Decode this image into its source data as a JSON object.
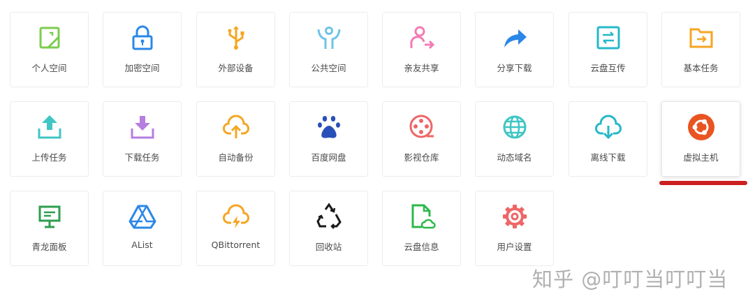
{
  "tiles": [
    {
      "label": "个人空间",
      "icon": "personal-space-icon",
      "color": "#7ccc4f"
    },
    {
      "label": "加密空间",
      "icon": "lock-icon",
      "color": "#2b87e8"
    },
    {
      "label": "外部设备",
      "icon": "usb-icon",
      "color": "#f5a623"
    },
    {
      "label": "公共空间",
      "icon": "public-space-icon",
      "color": "#6fc3e9"
    },
    {
      "label": "亲友共享",
      "icon": "share-user-icon",
      "color": "#f47bb4"
    },
    {
      "label": "分享下载",
      "icon": "share-arrow-icon",
      "color": "#2b87e8"
    },
    {
      "label": "云盘互传",
      "icon": "transfer-icon",
      "color": "#26b8c9"
    },
    {
      "label": "基本任务",
      "icon": "folder-arrow-icon",
      "color": "#f5a623"
    },
    {
      "label": "上传任务",
      "icon": "upload-icon",
      "color": "#3fc6c4"
    },
    {
      "label": "下载任务",
      "icon": "download-icon",
      "color": "#b57ee0"
    },
    {
      "label": "自动备份",
      "icon": "cloud-upload-icon",
      "color": "#f5a623"
    },
    {
      "label": "百度网盘",
      "icon": "baidu-paw-icon",
      "color": "#2950b8"
    },
    {
      "label": "影视仓库",
      "icon": "film-reel-icon",
      "color": "#ee6666"
    },
    {
      "label": "动态域名",
      "icon": "globe-icon",
      "color": "#3fc6c4"
    },
    {
      "label": "离线下载",
      "icon": "cloud-download-icon",
      "color": "#26b8c9"
    },
    {
      "label": "虚拟主机",
      "icon": "ubuntu-icon",
      "color": "#e95420"
    },
    {
      "label": "青龙面板",
      "icon": "monitor-icon",
      "color": "#2e9e4f"
    },
    {
      "label": "AList",
      "icon": "drive-triangle-icon",
      "color": "#2b87e8"
    },
    {
      "label": "QBittorrent",
      "icon": "cloud-bolt-icon",
      "color": "#f5a623"
    },
    {
      "label": "回收站",
      "icon": "recycle-icon",
      "color": "#1a1a1a"
    },
    {
      "label": "云盘信息",
      "icon": "cloud-file-icon",
      "color": "#2eb84a"
    },
    {
      "label": "用户设置",
      "icon": "gear-icon",
      "color": "#ee6666"
    }
  ],
  "watermark": "知乎 @叮叮当叮叮当",
  "highlight_color": "#cc1f1f"
}
